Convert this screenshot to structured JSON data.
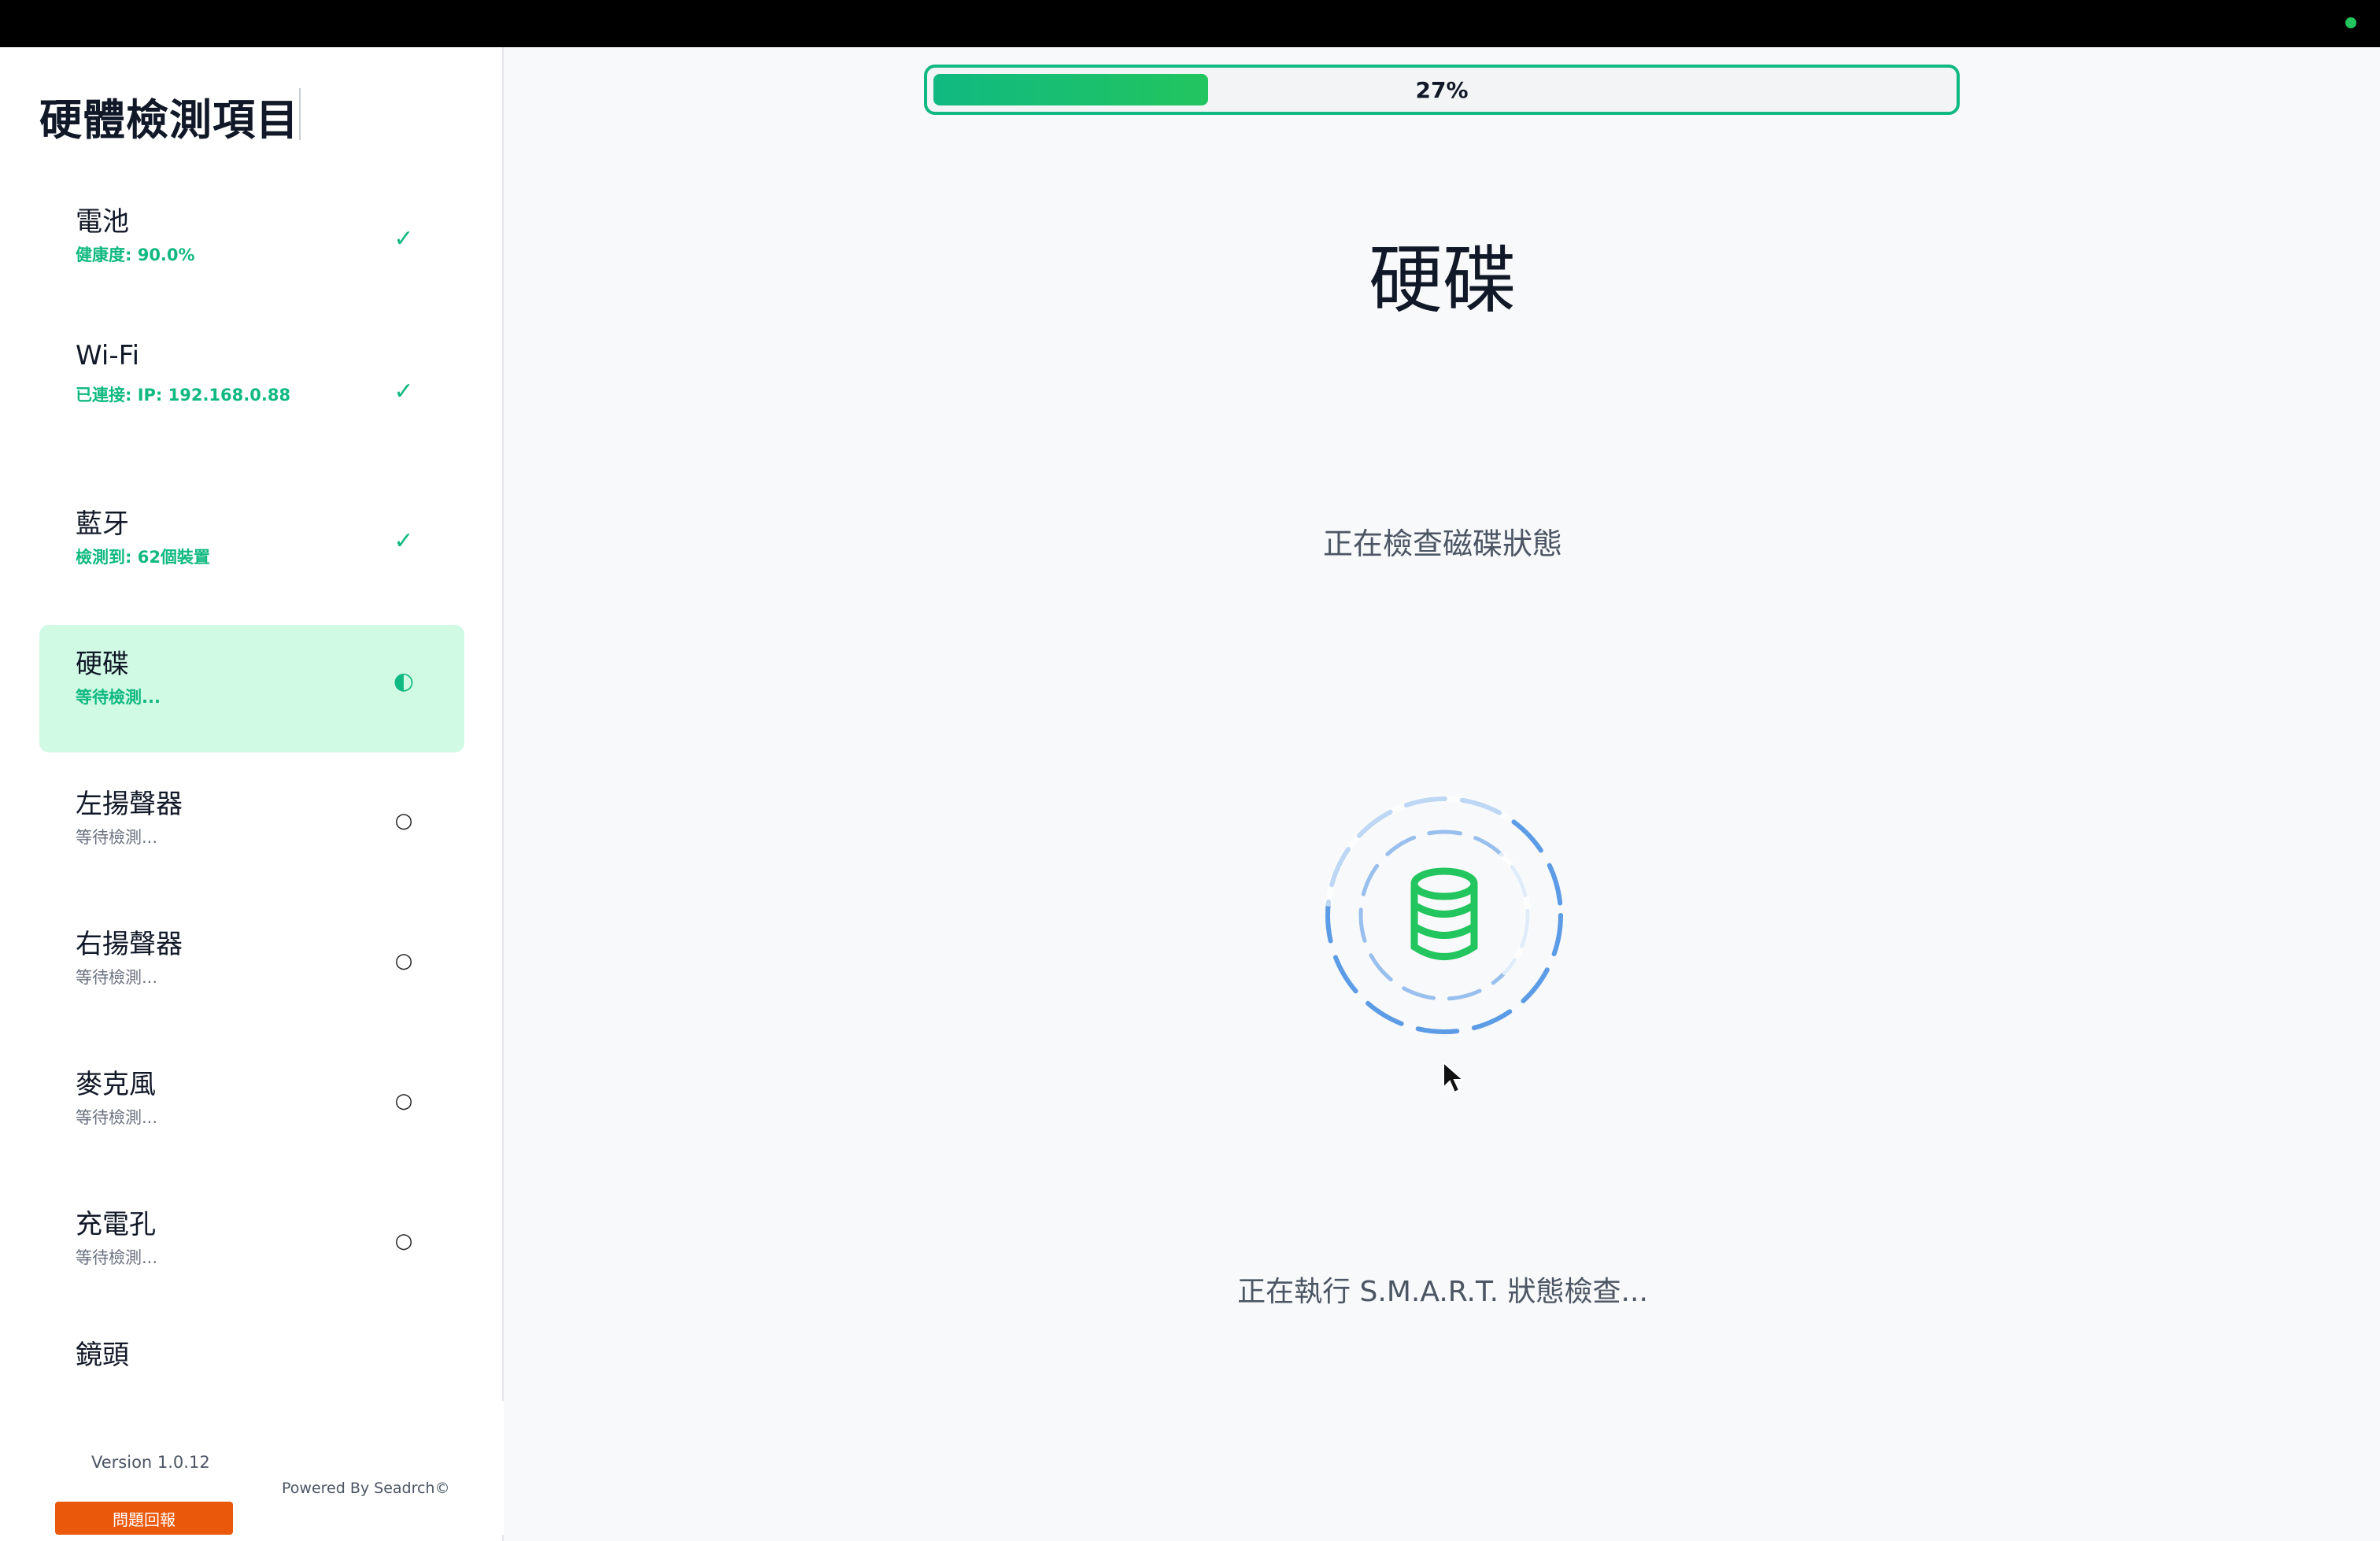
{
  "sidebar": {
    "title": "硬體檢測項目",
    "items": [
      {
        "name": "電池",
        "detail": "健康度: 90.0%",
        "status_icon": "✓",
        "state": "done"
      },
      {
        "name": "Wi-Fi",
        "detail": "已連接: IP: 192.168.0.88",
        "status_icon": "✓",
        "state": "done"
      },
      {
        "name": "藍牙",
        "detail": "檢測到: 62個裝置",
        "status_icon": "✓",
        "state": "done"
      },
      {
        "name": "硬碟",
        "detail": "等待檢測...",
        "status_icon": "◐",
        "state": "active"
      },
      {
        "name": "左揚聲器",
        "detail": "等待檢測...",
        "status_icon": "○",
        "state": "pending"
      },
      {
        "name": "右揚聲器",
        "detail": "等待檢測...",
        "status_icon": "○",
        "state": "pending"
      },
      {
        "name": "麥克風",
        "detail": "等待檢測...",
        "status_icon": "○",
        "state": "pending"
      },
      {
        "name": "充電孔",
        "detail": "等待檢測...",
        "status_icon": "○",
        "state": "pending"
      },
      {
        "name": "鏡頭",
        "detail": "",
        "status_icon": "",
        "state": "partial"
      }
    ],
    "version": "Version 1.0.12",
    "powered_by": "Powered By Seadrch©",
    "report_button": "問題回報"
  },
  "main": {
    "progress": {
      "value": 0.27,
      "label": "27%"
    },
    "title": "硬碟",
    "subtitle": "正在檢查磁碟狀態",
    "status": "正在執行 S.M.A.R.T. 狀態檢查...",
    "icon": "database-icon"
  },
  "colors": {
    "accent_green": "#10b981",
    "active_bg": "#d1fae5",
    "report_orange": "#ea580c",
    "spinner_blue": "#4a90e2"
  }
}
